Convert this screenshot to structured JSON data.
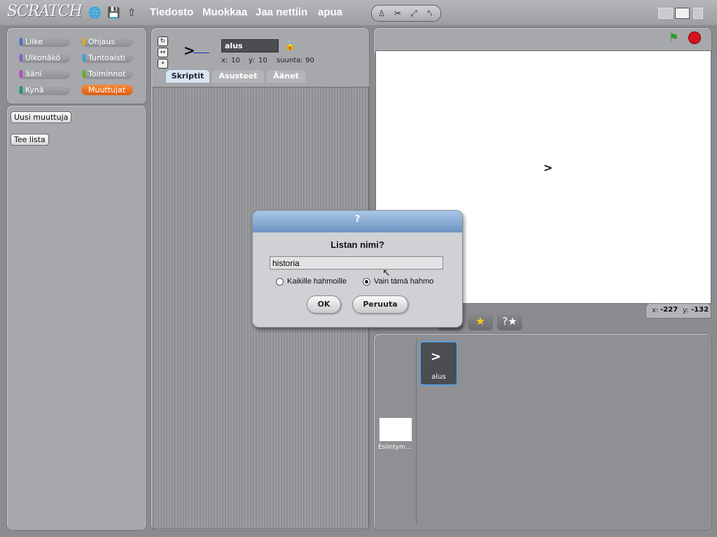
{
  "app": {
    "logo": "SCRATCH"
  },
  "menu": {
    "file": "Tiedosto",
    "edit": "Muokkaa",
    "share": "Jaa nettiin",
    "help": "apua"
  },
  "categories": {
    "motion": "Liike",
    "looks": "Ulkonäkö",
    "sound": "ääni",
    "pen": "Kynä",
    "control": "Ohjaus",
    "sensing": "Tuntoaisti",
    "operators": "Toiminnot",
    "variables": "Muuttujat"
  },
  "category_colors": {
    "motion": "#4a6cd4",
    "looks": "#8a55d7",
    "sound": "#bb42c3",
    "pen": "#0e9a6c",
    "control": "#e1a91a",
    "sensing": "#2ca5e2",
    "operators": "#5cb712",
    "variables": "#ee7d16"
  },
  "palette": {
    "new_variable": "Uusi muuttuja",
    "make_list": "Tee lista"
  },
  "sprite": {
    "name": "alus",
    "x_label": "x:",
    "x": "10",
    "y_label": "y:",
    "y": "10",
    "dir_label": "suunta:",
    "dir": "90",
    "glyph": ">"
  },
  "tabs": {
    "scripts": "Skriptit",
    "costumes": "Asusteet",
    "sounds": "Äänet"
  },
  "stage_info": {
    "x_label": "x:",
    "x": "-227",
    "y_label": "y:",
    "y": "-132",
    "stage_label": "Esiintym..."
  },
  "sprite_list": {
    "sprite_name": "alus",
    "sprite_glyph": ">"
  },
  "dialog": {
    "title": "?",
    "prompt": "Listan nimi?",
    "value": "historia",
    "radio_all": "Kaikille hahmoille",
    "radio_this": "Vain tämä hahmo",
    "ok": "OK",
    "cancel": "Peruuta"
  }
}
